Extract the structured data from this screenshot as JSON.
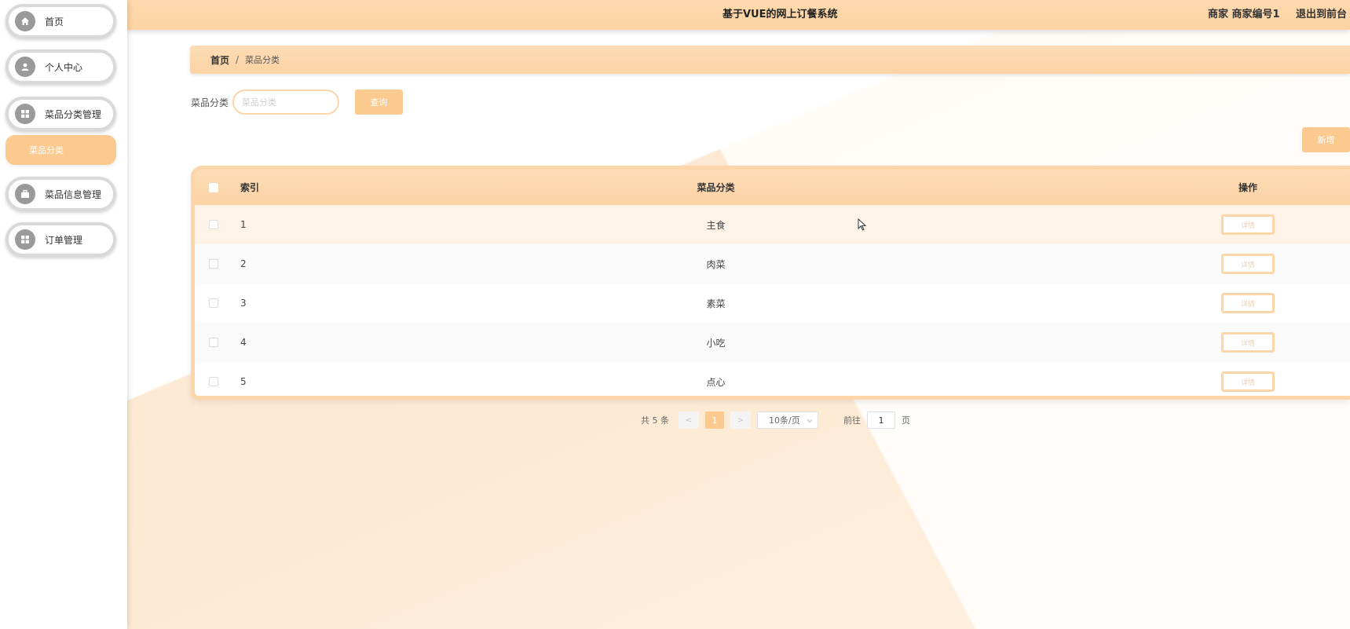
{
  "app": {
    "title": "基于VUE的网上订餐系统"
  },
  "header": {
    "user": "商家 商家编号1",
    "exit_label": "退出到前台"
  },
  "sidebar": {
    "items": [
      {
        "label": "首页",
        "icon": "home-icon"
      },
      {
        "label": "个人中心",
        "icon": "user-icon"
      },
      {
        "label": "菜品分类管理",
        "icon": "grid-icon"
      },
      {
        "label": "菜品信息管理",
        "icon": "briefcase-icon"
      },
      {
        "label": "订单管理",
        "icon": "grid-icon"
      }
    ],
    "submenu": {
      "label": "菜品分类"
    }
  },
  "breadcrumb": {
    "home": "首页",
    "separator": "/",
    "current": "菜品分类"
  },
  "search": {
    "label": "菜品分类",
    "placeholder": "菜品分类",
    "button_label": "查询"
  },
  "toolbar": {
    "add_label": "新增"
  },
  "table": {
    "headers": {
      "index": "索引",
      "category": "菜品分类",
      "operation": "操作"
    },
    "rows": [
      {
        "index": "1",
        "category": "主食",
        "action": "详情"
      },
      {
        "index": "2",
        "category": "肉菜",
        "action": "详情"
      },
      {
        "index": "3",
        "category": "素菜",
        "action": "详情"
      },
      {
        "index": "4",
        "category": "小吃",
        "action": "详情"
      },
      {
        "index": "5",
        "category": "点心",
        "action": "详情"
      }
    ]
  },
  "pagination": {
    "total": "共 5 条",
    "prev": "<",
    "current_page": "1",
    "next": ">",
    "page_size": "10条/页",
    "goto_label": "前往",
    "goto_value": "1",
    "page_suffix": "页"
  },
  "colors": {
    "accent": "#fcc98f",
    "topbar": "#fdd3a3",
    "border": "#fcd5a8",
    "menu_icon": "#9a9a9a"
  }
}
